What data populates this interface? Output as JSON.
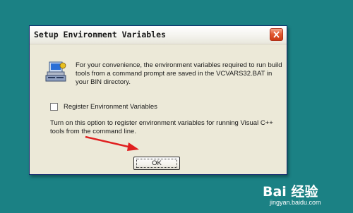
{
  "dialog": {
    "title": "Setup Environment Variables",
    "info_text": "For your convenience, the environment variables required to run build tools from a command prompt are saved in the VCVARS32.BAT in your BIN directory.",
    "checkbox_label": "Register Environment Variables",
    "checkbox_checked": false,
    "hint_text": "Turn on this option to register environment variables for running Visual C++ tools from the command line.",
    "ok_label": "OK"
  },
  "icons": {
    "close": "close-icon",
    "info": "computer-setup-icon",
    "arrow": "red-arrow-annotation"
  },
  "watermark": {
    "logo": "Bai 经验",
    "url": "jingyan.baidu.com"
  },
  "colors": {
    "desktop": "#1b8184",
    "dialog_bg": "#ece9d8",
    "close_button": "#e35b33",
    "arrow": "#e02020"
  }
}
